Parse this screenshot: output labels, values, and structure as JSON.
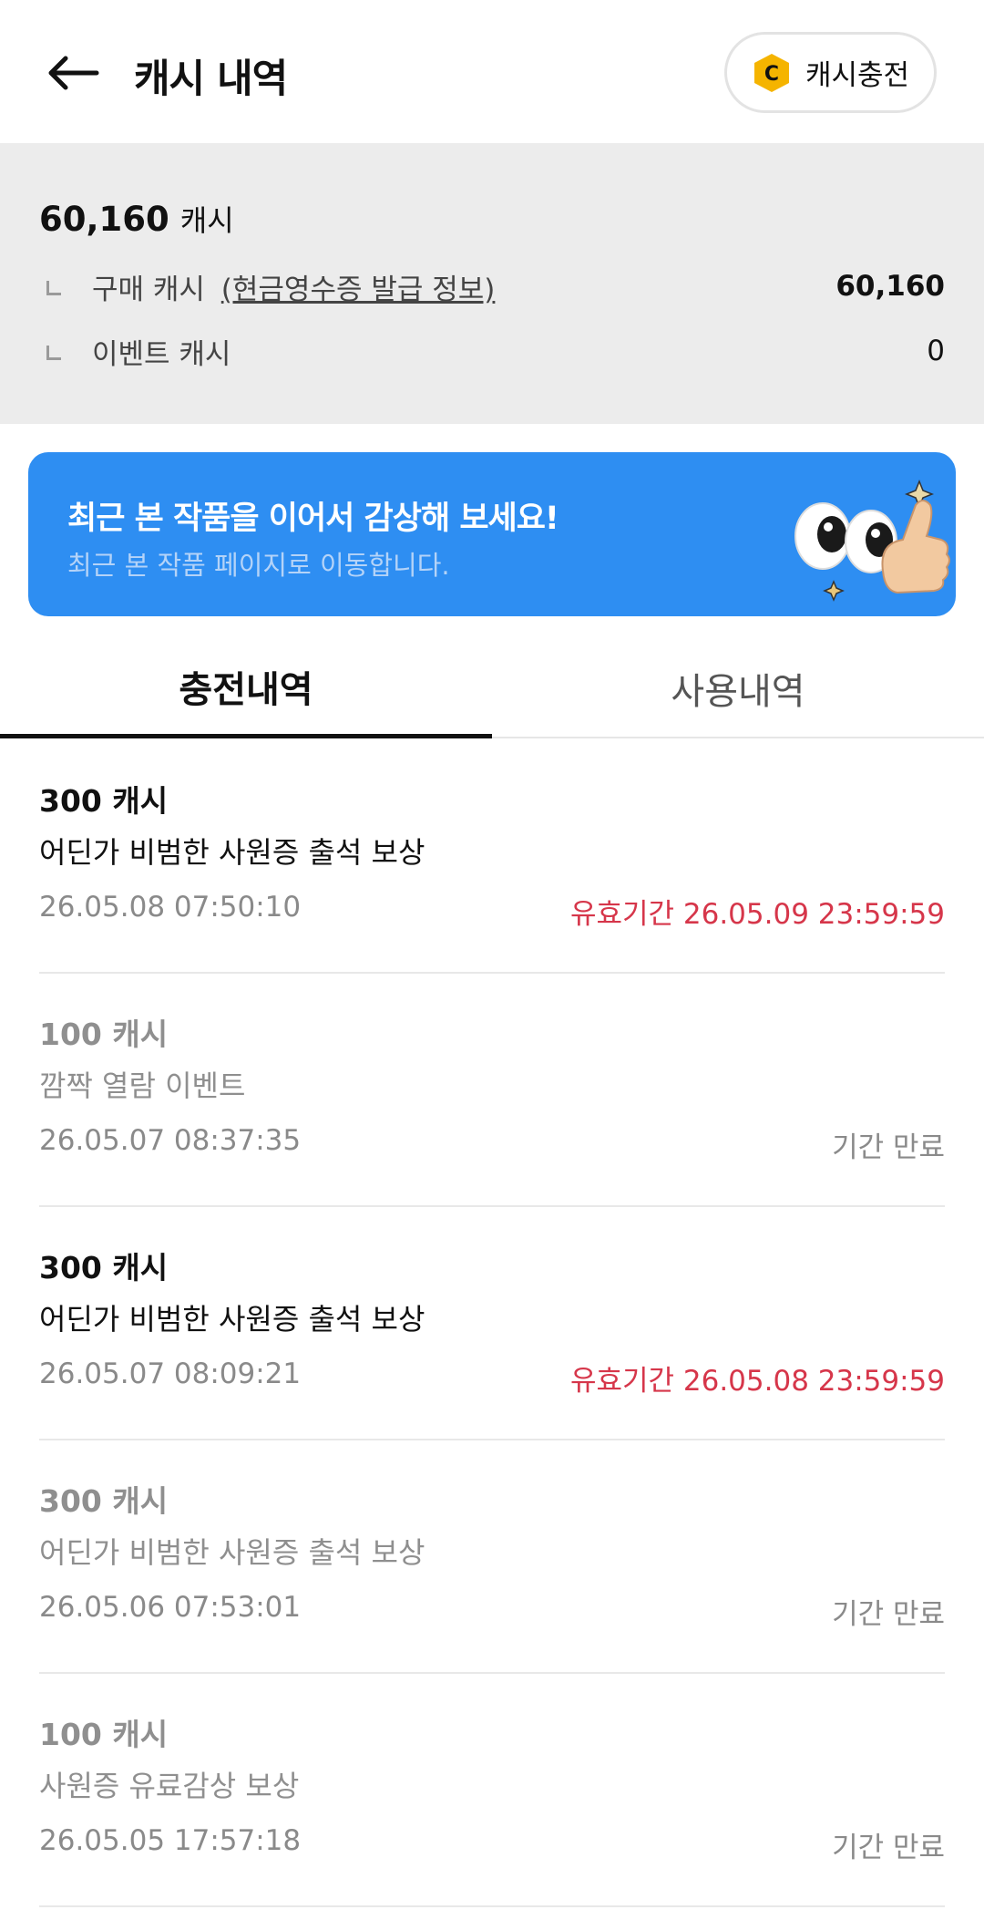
{
  "header": {
    "title": "캐시 내역",
    "charge_label": "캐시충전",
    "coin_letter": "C"
  },
  "balance": {
    "total": "60,160",
    "total_unit": "캐시",
    "purchase_label": "구매 캐시",
    "receipt_link": "(현금영수증 발급 정보)",
    "purchase_value": "60,160",
    "event_label": "이벤트 캐시",
    "event_value": "0"
  },
  "banner": {
    "title": "최근 본 작품을 이어서 감상해 보세요!",
    "subtitle": "최근 본 작품 페이지로 이동합니다.",
    "bg_color": "#2e8ef2"
  },
  "tabs": [
    {
      "label": "충전내역",
      "active": true
    },
    {
      "label": "사용내역",
      "active": false
    }
  ],
  "items": [
    {
      "amount": "300 캐시",
      "desc": "어딘가 비범한 사원증 출석 보상",
      "date": "26.05.08 07:50:10",
      "status": "유효기간 26.05.09 23:59:59",
      "state": "valid"
    },
    {
      "amount": "100 캐시",
      "desc": "깜짝 열람 이벤트",
      "date": "26.05.07 08:37:35",
      "status": "기간 만료",
      "state": "expired"
    },
    {
      "amount": "300 캐시",
      "desc": "어딘가 비범한 사원증 출석 보상",
      "date": "26.05.07 08:09:21",
      "status": "유효기간 26.05.08 23:59:59",
      "state": "valid"
    },
    {
      "amount": "300 캐시",
      "desc": "어딘가 비범한 사원증 출석 보상",
      "date": "26.05.06 07:53:01",
      "status": "기간 만료",
      "state": "expired"
    },
    {
      "amount": "100 캐시",
      "desc": "사원증 유료감상 보상",
      "date": "26.05.05 17:57:18",
      "status": "기간 만료",
      "state": "expired"
    }
  ],
  "colors": {
    "accent_red": "#d6364a",
    "coin_yellow": "#f5b400"
  },
  "icons": {
    "back": "arrow-left-icon",
    "coin": "cash-coin-icon",
    "mascot": "eyes-thumbs-up-mascot"
  }
}
